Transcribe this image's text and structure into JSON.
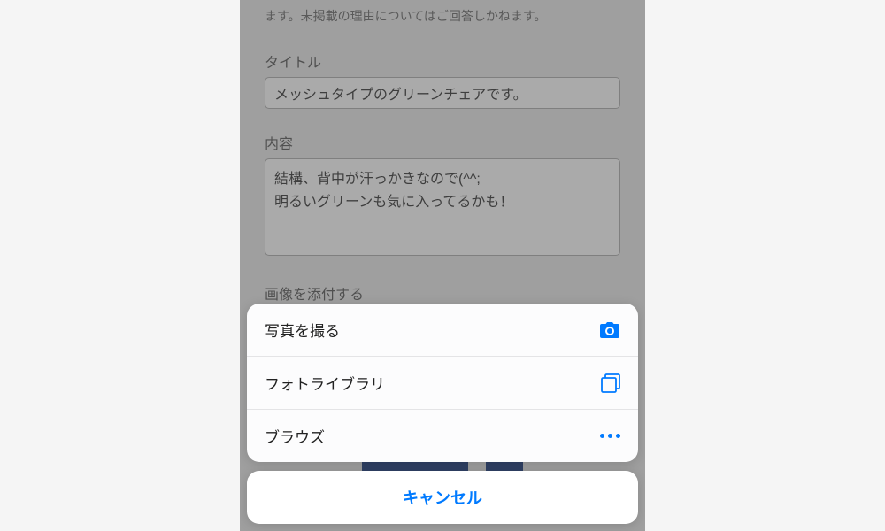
{
  "form": {
    "notice": "ます。未掲載の理由についてはご回答しかねます。",
    "title_label": "タイトル",
    "title_value": "メッシュタイプのグリーンチェアです。",
    "content_label": "内容",
    "content_value": "結構、背中が汗っかきなので(^^;\n明るいグリーンも気に入ってるかも！",
    "attach_label": "画像を添付する"
  },
  "sheet": {
    "take_photo": "写真を撮る",
    "photo_library": "フォトライブラリ",
    "browse": "ブラウズ",
    "cancel": "キャンセル"
  }
}
